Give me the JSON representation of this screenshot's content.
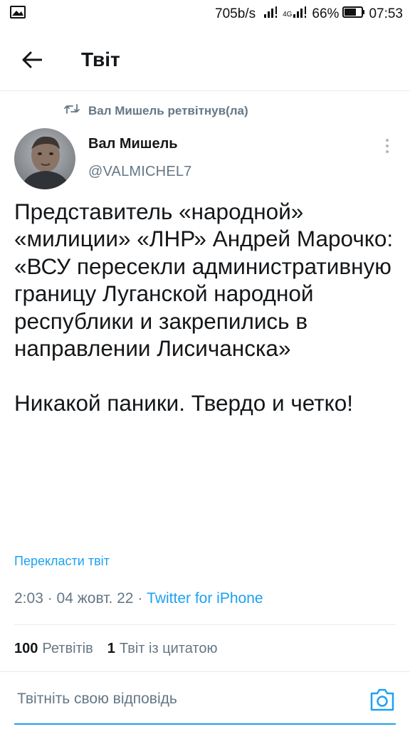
{
  "status_bar": {
    "network_speed": "705b/s",
    "battery": "66%",
    "time": "07:53",
    "signal_label": "4G",
    "icons": [
      "gallery-icon",
      "signal-icon",
      "battery-icon"
    ]
  },
  "header": {
    "title": "Твіт",
    "back_icon": "arrow-left-icon"
  },
  "retweet_line": "Вал Мишель ретвітнув(ла)",
  "author": {
    "name": "Вал Мишель",
    "handle": "@VALMICHEL7"
  },
  "tweet_text": "Представитель «народной» «милиции» «ЛНР» Андрей Марочко:\n«ВСУ пересекли административную границу Луганской народной республики и закрепились в направлении Лисичанска»\n\nНикакой паники. Твердо и четко!",
  "translate_label": "Перекласти твіт",
  "meta": {
    "time": "2:03",
    "separator": " · ",
    "date": "04 жовт. 22",
    "source": "Twitter for iPhone"
  },
  "stats": {
    "retweets_count": "100",
    "retweets_label": "Ретвітів",
    "quotes_count": "1",
    "quotes_label": "Твіт із цитатою"
  },
  "reply": {
    "placeholder": "Твітніть свою відповідь"
  },
  "colors": {
    "accent": "#1da1f2",
    "secondary_text": "#657786",
    "divider": "#e6ecf0"
  }
}
